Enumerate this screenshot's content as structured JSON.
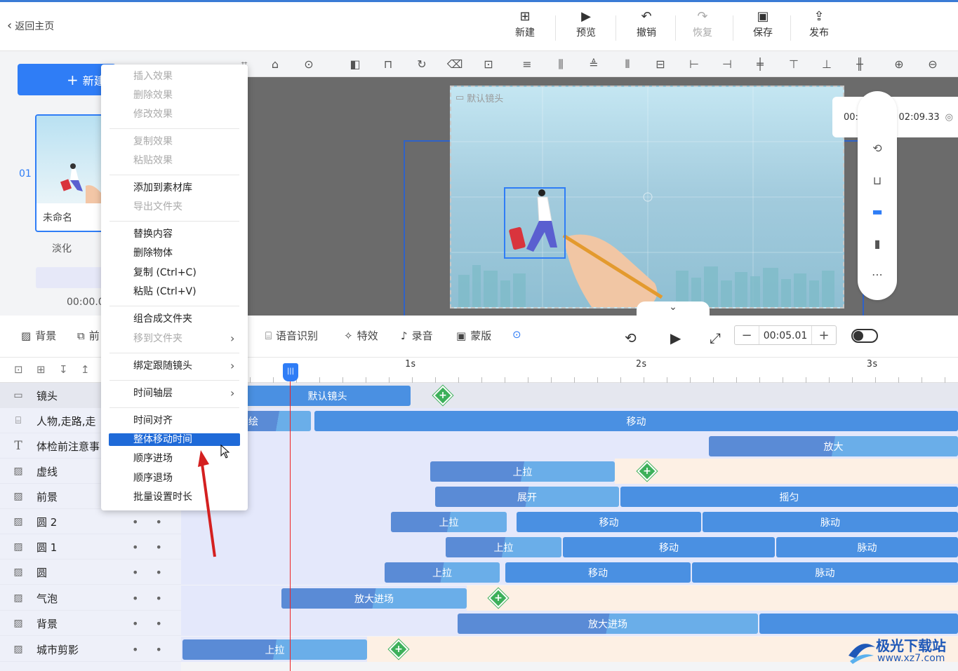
{
  "header": {
    "back_label": "返回主页",
    "buttons": [
      {
        "label": "新建",
        "icon": "plus-box-icon",
        "disabled": false
      },
      {
        "label": "预览",
        "icon": "play-icon",
        "disabled": false
      },
      {
        "label": "撤销",
        "icon": "undo-icon",
        "disabled": false
      },
      {
        "label": "恢复",
        "icon": "redo-icon",
        "disabled": true
      },
      {
        "label": "保存",
        "icon": "save-icon",
        "disabled": false
      },
      {
        "label": "发布",
        "icon": "publish-icon",
        "disabled": false
      }
    ]
  },
  "scenes": {
    "new_label": "新建",
    "number": "01",
    "name": "未命名",
    "transition": "淡化",
    "time": "00:00.0"
  },
  "stage": {
    "camera_label": "默认镜头",
    "time_current": "00:00.48",
    "time_sep": "/",
    "time_total": "02:09.33"
  },
  "midbar": {
    "items": [
      "背景",
      "前",
      "语音识别",
      "特效",
      "录音",
      "蒙版"
    ],
    "time_value": "00:05.01",
    "minus": "−",
    "plus": "+"
  },
  "ruler": {
    "labels": [
      "1s",
      "2s",
      "3s"
    ]
  },
  "tracks": [
    {
      "name": "镜头",
      "icon": "camera-icon"
    },
    {
      "name": "人物,走路,走",
      "icon": "svg-icon"
    },
    {
      "name": "体检前注意事",
      "icon": "text-icon"
    },
    {
      "name": "虚线",
      "icon": "image-icon"
    },
    {
      "name": "前景",
      "icon": "image-icon"
    },
    {
      "name": "圆 2",
      "icon": "image-icon"
    },
    {
      "name": "圆 1",
      "icon": "image-icon"
    },
    {
      "name": "圆",
      "icon": "image-icon"
    },
    {
      "name": "气泡",
      "icon": "image-icon"
    },
    {
      "name": "背景",
      "icon": "image-icon"
    },
    {
      "name": "城市剪影",
      "icon": "image-icon"
    }
  ],
  "segments": {
    "cam": "默认镜头",
    "person_a": "绘",
    "person_b": "移动",
    "text_a": "放大",
    "dash_a": "上拉",
    "fore_a": "展开",
    "fore_b": "摇匀",
    "c2_a": "上拉",
    "c2_b": "移动",
    "c2_c": "脉动",
    "c1_a": "上拉",
    "c1_b": "移动",
    "c1_c": "脉动",
    "c_a": "上拉",
    "c_b": "移动",
    "c_c": "脉动",
    "bubble_a": "放大进场",
    "bg_a": "放大进场",
    "city_a": "上拉",
    "add": "+"
  },
  "context_menu": {
    "items": [
      {
        "label": "插入效果",
        "disabled": true
      },
      {
        "label": "删除效果",
        "disabled": true
      },
      {
        "label": "修改效果",
        "disabled": true
      },
      {
        "label": "复制效果",
        "disabled": true
      },
      {
        "label": "粘贴效果",
        "disabled": true
      },
      {
        "label": "添加到素材库",
        "disabled": false
      },
      {
        "label": "导出文件夹",
        "disabled": true
      },
      {
        "label": "替换内容",
        "disabled": false
      },
      {
        "label": "删除物体",
        "disabled": false
      },
      {
        "label": "复制 (Ctrl+C)",
        "disabled": false
      },
      {
        "label": "粘贴 (Ctrl+V)",
        "disabled": false
      },
      {
        "label": "组合成文件夹",
        "disabled": false
      },
      {
        "label": "移到文件夹",
        "disabled": true
      },
      {
        "label": "绑定跟随镜头",
        "disabled": false
      },
      {
        "label": "时间轴层",
        "disabled": false
      },
      {
        "label": "时间对齐",
        "disabled": false
      },
      {
        "label": "整体移动时间",
        "disabled": false,
        "highlighted": true
      },
      {
        "label": "顺序进场",
        "disabled": false
      },
      {
        "label": "顺序退场",
        "disabled": false
      },
      {
        "label": "批量设置时长",
        "disabled": false
      }
    ]
  },
  "watermark": {
    "text": "极光下载站",
    "url": "www.xz7.com"
  },
  "colors": {
    "accent": "#2f7df6",
    "segment": "#4a90e2",
    "lane": "#e4e8fb",
    "peach": "#fdf0e4",
    "add_green": "#3db05a",
    "playhead": "#e22222"
  }
}
